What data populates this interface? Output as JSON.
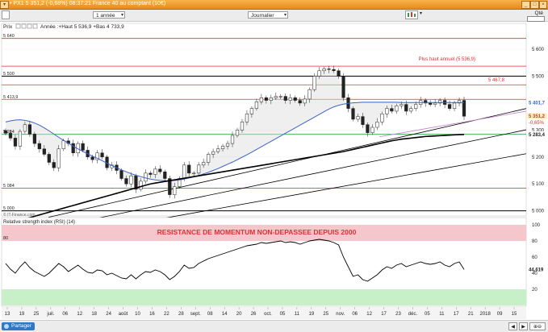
{
  "window": {
    "title": "• PX1",
    "last": "5 351,2",
    "change": "(-0,68%)",
    "time": "08:37:21",
    "instrument": "France 40 au comptant (10€)"
  },
  "toolbar": {
    "period": "1 année",
    "interval": "Journalier",
    "qte_label": "Qté",
    "qte_value": "1"
  },
  "main": {
    "series_label": "Prix",
    "info": "Année :+Haut 5 536,9 +Bas 4 733,9",
    "watermark": "© IT-Finance.com",
    "annotation_high": "Plus haut annuel (5 536,9)",
    "annotation_level": "5 467,8",
    "price_badge": "5 351,2",
    "change_badge": "-0,65%",
    "ma_badge": "5 401,7",
    "ma200_badge": "5 283,4"
  },
  "rsi": {
    "label": "Relative strength index (RSI) (14)",
    "banner": "RESISTANCE DE MOMENTUM NON-DEPASSEE DEPUIS 2000",
    "value_label": "44,619",
    "left_label": "80"
  },
  "bottom": {
    "share_label": "Partager"
  },
  "colors": {
    "title_bar": "#e8891b",
    "red_line": "#e03030",
    "green_line": "#2f9e44",
    "ma_blue": "#3a63c8",
    "ma_black": "#000000",
    "rsi_band_red": "#f5c6cc",
    "rsi_band_green": "#c8f0c8",
    "badge_blue": "#3a63c8",
    "badge_red": "#e03030"
  },
  "chart_data": {
    "type": "candlestick",
    "ylim": [
      4990,
      5660
    ],
    "y_ticks": [
      5000,
      5100,
      5200,
      5300,
      5400,
      5500,
      5600
    ],
    "left_labels": [
      {
        "value": 5640,
        "text": "5 640"
      },
      {
        "value": 5500,
        "text": "5 500"
      },
      {
        "value": 5413.9,
        "text": "5 413,9"
      },
      {
        "value": 5284,
        "text": "5 284"
      },
      {
        "value": 5084,
        "text": "5 084"
      },
      {
        "value": 5000,
        "text": "5 000"
      }
    ],
    "x_labels": [
      "13",
      "19",
      "25",
      "juil.",
      "06",
      "12",
      "18",
      "24",
      "août",
      "10",
      "16",
      "22",
      "28",
      "sept.",
      "08",
      "14",
      "20",
      "26",
      "oct.",
      "05",
      "11",
      "19",
      "25",
      "nov.",
      "06",
      "12",
      "17",
      "23",
      "déc.",
      "05",
      "11",
      "17",
      "21",
      "2018",
      "09",
      "15"
    ],
    "horizontal_lines": [
      {
        "value": 5640,
        "color": "red"
      },
      {
        "value": 5536.9,
        "color": "red"
      },
      {
        "value": 5500,
        "color": "black"
      },
      {
        "value": 5467.8,
        "color": "red"
      },
      {
        "value": 5413.9,
        "color": "red"
      },
      {
        "value": 5284,
        "color": "green"
      },
      {
        "value": 5084,
        "color": "green"
      },
      {
        "value": 5000,
        "color": "black"
      }
    ],
    "close": [
      5288,
      5270,
      5240,
      5295,
      5320,
      5285,
      5250,
      5230,
      5210,
      5180,
      5160,
      5230,
      5260,
      5250,
      5215,
      5250,
      5225,
      5200,
      5190,
      5215,
      5200,
      5160,
      5170,
      5150,
      5120,
      5100,
      5130,
      5080,
      5110,
      5140,
      5135,
      5155,
      5145,
      5120,
      5060,
      5090,
      5120,
      5170,
      5140,
      5140,
      5170,
      5180,
      5210,
      5220,
      5230,
      5240,
      5250,
      5280,
      5300,
      5330,
      5360,
      5380,
      5405,
      5420,
      5410,
      5420,
      5425,
      5425,
      5410,
      5420,
      5410,
      5400,
      5415,
      5450,
      5500,
      5520,
      5527,
      5525,
      5520,
      5500,
      5420,
      5380,
      5340,
      5350,
      5320,
      5290,
      5310,
      5330,
      5360,
      5380,
      5370,
      5390,
      5395,
      5370,
      5380,
      5395,
      5410,
      5400,
      5395,
      5400,
      5410,
      5395,
      5380,
      5400,
      5410,
      5351.2
    ],
    "ma50": [
      5330,
      5334,
      5337,
      5338,
      5336,
      5332,
      5326,
      5318,
      5308,
      5297,
      5285,
      5273,
      5262,
      5251,
      5240,
      5230,
      5221,
      5212,
      5203,
      5195,
      5186,
      5177,
      5168,
      5160,
      5152,
      5145,
      5138,
      5132,
      5127,
      5122,
      5118,
      5115,
      5113,
      5112,
      5112,
      5113,
      5115,
      5118,
      5122,
      5126,
      5131,
      5137,
      5143,
      5150,
      5157,
      5165,
      5173,
      5181,
      5190,
      5199,
      5208,
      5218,
      5228,
      5238,
      5248,
      5258,
      5268,
      5278,
      5288,
      5298,
      5308,
      5318,
      5328,
      5338,
      5348,
      5358,
      5368,
      5378,
      5386,
      5392,
      5396,
      5399,
      5401,
      5402,
      5403,
      5403,
      5403,
      5403,
      5403,
      5403,
      5403,
      5403,
      5402,
      5402,
      5402,
      5402,
      5402,
      5402,
      5402,
      5402,
      5402,
      5402,
      5402,
      5402,
      5402,
      5401.7
    ],
    "ma200": [
      4950,
      4955,
      4960,
      4965,
      4970,
      4975,
      4980,
      4985,
      4990,
      4995,
      5000,
      5005,
      5010,
      5015,
      5020,
      5025,
      5030,
      5035,
      5040,
      5045,
      5050,
      5055,
      5060,
      5065,
      5070,
      5075,
      5080,
      5085,
      5090,
      5095,
      5100,
      5103,
      5106,
      5109,
      5112,
      5115,
      5118,
      5121,
      5124,
      5127,
      5130,
      5133,
      5136,
      5139,
      5142,
      5145,
      5148,
      5151,
      5154,
      5157,
      5160,
      5163,
      5166,
      5169,
      5172,
      5175,
      5178,
      5181,
      5184,
      5187,
      5190,
      5193,
      5196,
      5199,
      5202,
      5205,
      5208,
      5211,
      5214,
      5217,
      5220,
      5224,
      5228,
      5232,
      5236,
      5240,
      5244,
      5248,
      5252,
      5256,
      5260,
      5263,
      5266,
      5268,
      5270,
      5272,
      5274,
      5276,
      5277,
      5278,
      5279,
      5280,
      5281,
      5282,
      5283,
      5283.4
    ],
    "rsi": {
      "ylim": [
        0,
        100
      ],
      "ticks": [
        20,
        40,
        60,
        80,
        100
      ],
      "bands": [
        {
          "from": 80,
          "to": 100,
          "color": "red"
        },
        {
          "from": 0,
          "to": 20,
          "color": "green"
        }
      ],
      "values": [
        52,
        45,
        40,
        48,
        54,
        47,
        42,
        39,
        36,
        40,
        46,
        52,
        48,
        42,
        46,
        50,
        45,
        41,
        40,
        44,
        43,
        38,
        40,
        37,
        34,
        33,
        38,
        33,
        38,
        42,
        41,
        44,
        42,
        38,
        32,
        36,
        42,
        50,
        46,
        47,
        52,
        55,
        58,
        60,
        62,
        64,
        66,
        68,
        70,
        72,
        74,
        75,
        76,
        78,
        77,
        78,
        79,
        80,
        78,
        79,
        78,
        76,
        78,
        80,
        81,
        82,
        81,
        80,
        78,
        75,
        60,
        48,
        36,
        38,
        32,
        30,
        34,
        38,
        44,
        48,
        46,
        50,
        52,
        48,
        50,
        52,
        54,
        52,
        51,
        52,
        54,
        50,
        48,
        52,
        54,
        44.6
      ]
    }
  }
}
